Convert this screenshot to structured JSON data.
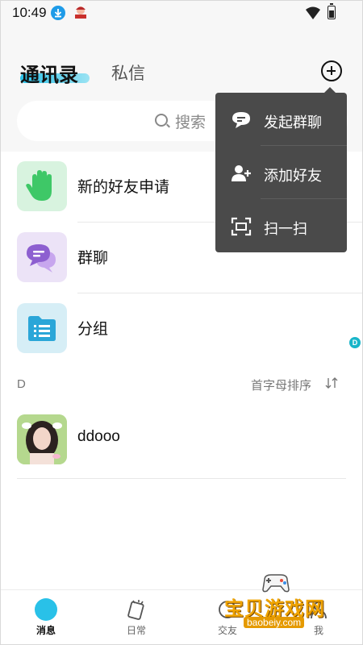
{
  "status_bar": {
    "time": "10:49"
  },
  "header": {
    "active_tab": "通讯录",
    "inactive_tab": "私信",
    "search_placeholder": "搜索"
  },
  "list": {
    "items": [
      {
        "label": "新的好友申请",
        "icon": "waving-hand-icon"
      },
      {
        "label": "群聊",
        "icon": "group-chat-icon"
      },
      {
        "label": "分组",
        "icon": "folder-icon"
      }
    ],
    "section": {
      "letter": "D",
      "sort_label": "首字母排序"
    },
    "contacts": [
      {
        "name": "ddooo"
      }
    ]
  },
  "index_badge": "D",
  "popup_menu": {
    "items": [
      {
        "label": "发起群聊",
        "icon": "start-chat-icon"
      },
      {
        "label": "添加好友",
        "icon": "add-friend-icon"
      },
      {
        "label": "扫一扫",
        "icon": "scan-icon"
      }
    ]
  },
  "tab_bar": {
    "items": [
      {
        "label": "消息",
        "active": true
      },
      {
        "label": "日常",
        "active": false
      },
      {
        "label": "交友",
        "active": false
      },
      {
        "label": "我",
        "active": false
      }
    ]
  },
  "watermark": {
    "text": "宝贝游戏网",
    "url": "baobeiy.com"
  },
  "colors": {
    "accent": "#29c1e8",
    "popup_bg": "#4a4a4a",
    "hand_green": "#3ec867",
    "chat_purple": "#8d5fd0",
    "folder_blue": "#2aa6d8"
  }
}
